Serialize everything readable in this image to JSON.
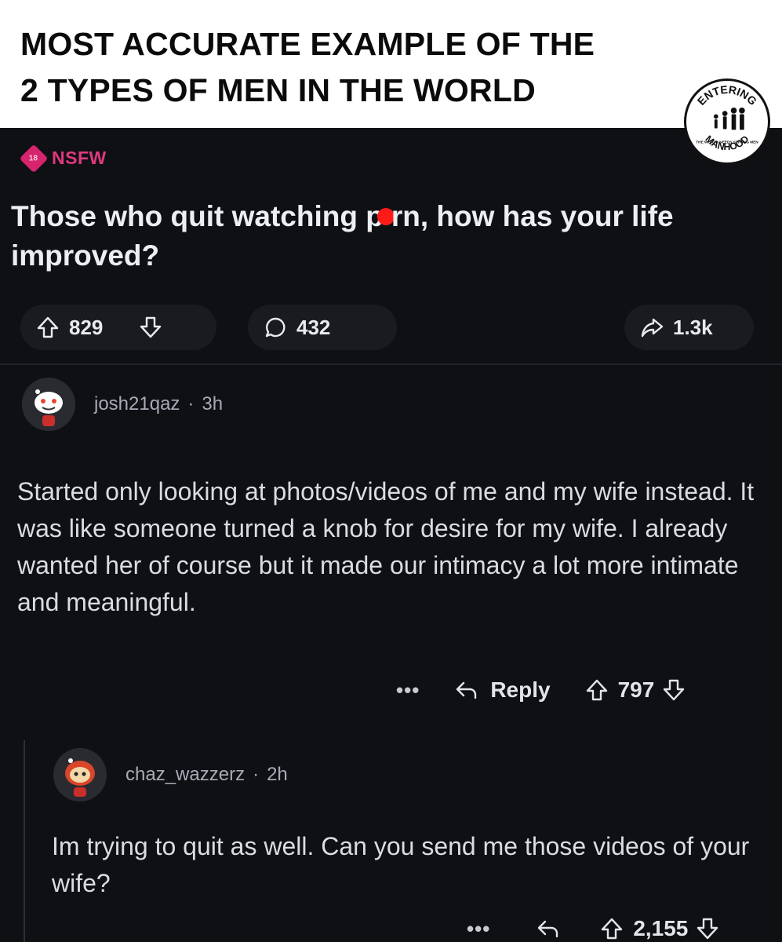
{
  "caption": {
    "line1": "MOST ACCURATE EXAMPLE OF THE",
    "line2": "2 TYPES OF MEN IN THE WORLD"
  },
  "logo": {
    "top_text": "ENTERING",
    "bottom_text": "MANHOOD",
    "tagline": "THE WORLD NEEDS STRONG MEN"
  },
  "post": {
    "badge_label": "NSFW",
    "title_part1": "Those who quit watching p",
    "title_part2": "rn, how has your life improved?",
    "upvotes": "829",
    "comments": "432",
    "shares": "1.3k"
  },
  "comments": [
    {
      "author": "josh21qaz",
      "separator": "·",
      "age": "3h",
      "body": "Started only looking at photos/videos of me and my wife instead. It was like someone turned a knob for desire for my wife. I already wanted her of course but it made our intimacy a lot more intimate and meaningful.",
      "more_label": "•••",
      "reply_label": "Reply",
      "votes": "797"
    },
    {
      "author": "chaz_wazzerz",
      "separator": "·",
      "age": "2h",
      "body": "Im trying to quit as well. Can you send me those videos of your wife?",
      "more_label": "•••",
      "votes": "2,155"
    }
  ],
  "colors": {
    "background": "#0f1014",
    "nsfw": "#e0387f",
    "text": "#e9eaee",
    "redaction": "#ff1a1a"
  },
  "icons": [
    "upvote-icon",
    "downvote-icon",
    "comment-icon",
    "share-icon",
    "reply-icon",
    "more-icon"
  ]
}
